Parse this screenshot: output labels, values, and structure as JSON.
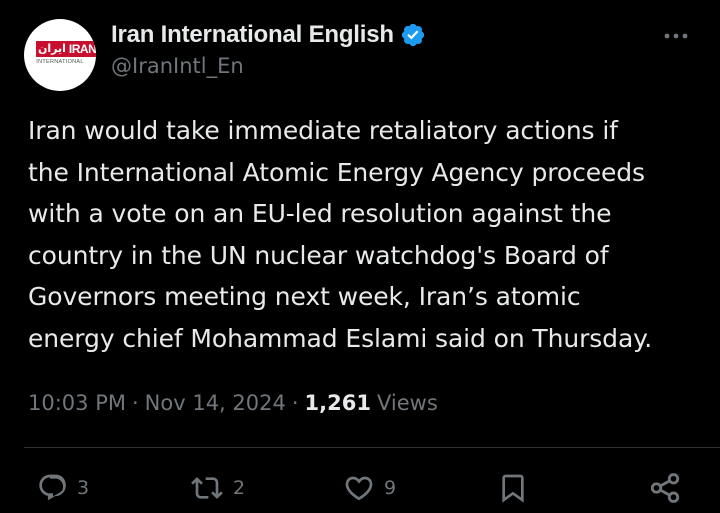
{
  "author": {
    "display_name": "Iran International English",
    "handle": "@IranIntl_En",
    "verified": true,
    "avatar_logo": {
      "script_text": "ایران",
      "main_text": "IRAN",
      "sub_text": "INTERNATIONAL"
    }
  },
  "tweet": {
    "text_lines": [
      "Iran would take immediate retaliatory actions if",
      "the International Atomic Energy Agency proceeds",
      "with a vote on an EU-led resolution against the",
      "country in the UN nuclear watchdog's Board of",
      "Governors meeting next week, Iran’s atomic",
      "energy chief Mohammad Eslami said on Thursday."
    ],
    "time": "10:03 PM",
    "date": "Nov 14, 2024",
    "separator": "·",
    "views_count": "1,261",
    "views_label": "Views"
  },
  "actions": {
    "replies": "3",
    "reposts": "2",
    "likes": "9"
  },
  "colors": {
    "background": "#000000",
    "text_primary": "#e7e9ea",
    "text_secondary": "#71767b",
    "verified_blue": "#1d9bf0",
    "brand_red": "#c8102e",
    "divider": "#2f3336"
  },
  "icons": {
    "verified": "verified-badge-icon",
    "more": "more-options-icon",
    "reply": "reply-icon",
    "repost": "repost-icon",
    "like": "like-icon",
    "bookmark": "bookmark-icon",
    "share": "share-icon"
  }
}
